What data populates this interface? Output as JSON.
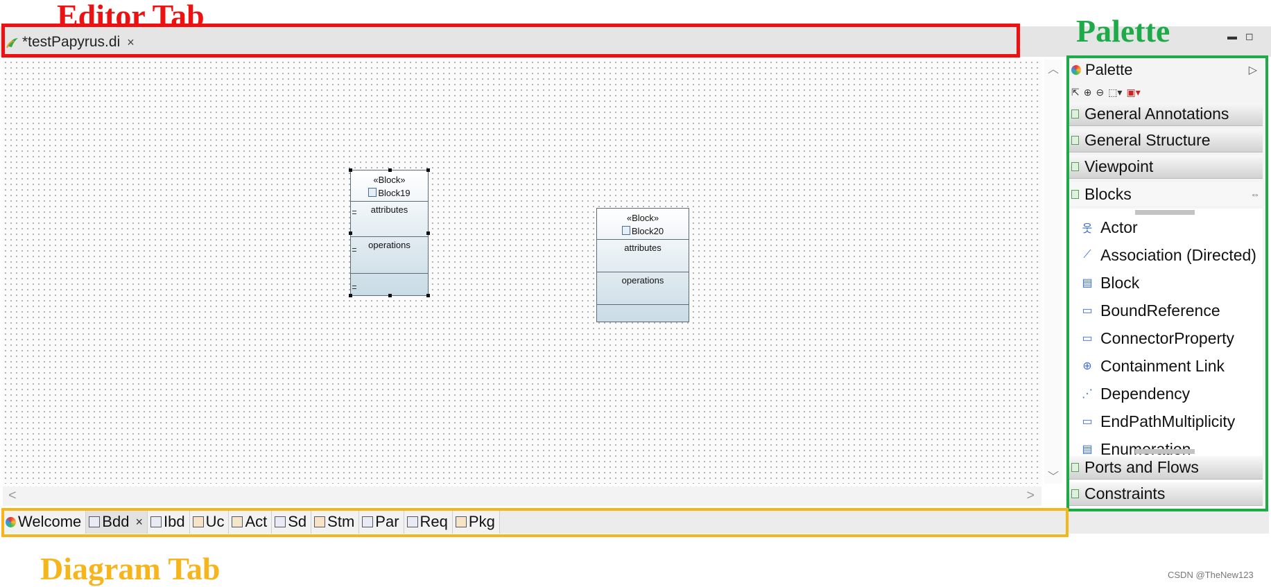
{
  "annotations": {
    "editor_tab_label": "Editor Tab",
    "palette_label": "Palette",
    "diagram_tab_label": "Diagram Tab",
    "watermark": "CSDN @TheNew123",
    "colors": {
      "editor": "#ee1111",
      "palette": "#1faa4a",
      "diagram": "#f6b51a"
    }
  },
  "editor": {
    "tab_title": "*testPapyrus.di",
    "tab_icon": "papyrus-icon",
    "close_glyph": "×",
    "window_controls": {
      "minimize": "▬",
      "maximize": "◻"
    }
  },
  "canvas": {
    "blocks": [
      {
        "stereotype": "«Block»",
        "name": "Block19",
        "attributes": "attributes",
        "operations": "operations",
        "selected": true
      },
      {
        "stereotype": "«Block»",
        "name": "Block20",
        "attributes": "attributes",
        "operations": "operations",
        "selected": false
      }
    ],
    "scroll": {
      "up": "︿",
      "down": "﹀",
      "left": "<",
      "right": ">"
    }
  },
  "palette": {
    "title": "Palette",
    "expand_glyph": "▷",
    "tools": [
      "select-tool-icon",
      "zoom-in-icon",
      "zoom-out-icon",
      "marquee-icon",
      "note-tool-icon"
    ],
    "drawers_top": [
      "General Annotations",
      "General Structure",
      "Viewpoint",
      "Blocks"
    ],
    "blocks_pin_glyph": "⇔",
    "items": [
      {
        "label": "Actor",
        "icon": "actor-icon",
        "glyph": "웃"
      },
      {
        "label": "Association (Directed)",
        "icon": "association-icon",
        "glyph": "⟋"
      },
      {
        "label": "Block",
        "icon": "block-icon",
        "glyph": "▤"
      },
      {
        "label": "BoundReference",
        "icon": "property-icon",
        "glyph": "▭"
      },
      {
        "label": "ConnectorProperty",
        "icon": "property-icon",
        "glyph": "▭"
      },
      {
        "label": "Containment Link",
        "icon": "containment-icon",
        "glyph": "⊕"
      },
      {
        "label": "Dependency",
        "icon": "dependency-icon",
        "glyph": "⋰"
      },
      {
        "label": "EndPathMultiplicity",
        "icon": "property-icon",
        "glyph": "▭"
      },
      {
        "label": "Enumeration",
        "icon": "enumeration-icon",
        "glyph": "▤"
      }
    ],
    "drawers_bottom": [
      "Ports and Flows",
      "Constraints"
    ]
  },
  "diagram_tabs": [
    {
      "label": "Welcome",
      "icon": "welcome-icon",
      "active": false
    },
    {
      "label": "Bdd",
      "icon": "bdd-icon",
      "active": true,
      "close": "×"
    },
    {
      "label": "Ibd",
      "icon": "ibd-icon",
      "active": false
    },
    {
      "label": "Uc",
      "icon": "uc-icon",
      "active": false
    },
    {
      "label": "Act",
      "icon": "act-icon",
      "active": false
    },
    {
      "label": "Sd",
      "icon": "sd-icon",
      "active": false
    },
    {
      "label": "Stm",
      "icon": "stm-icon",
      "active": false
    },
    {
      "label": "Par",
      "icon": "par-icon",
      "active": false
    },
    {
      "label": "Req",
      "icon": "req-icon",
      "active": false
    },
    {
      "label": "Pkg",
      "icon": "pkg-icon",
      "active": false
    }
  ]
}
